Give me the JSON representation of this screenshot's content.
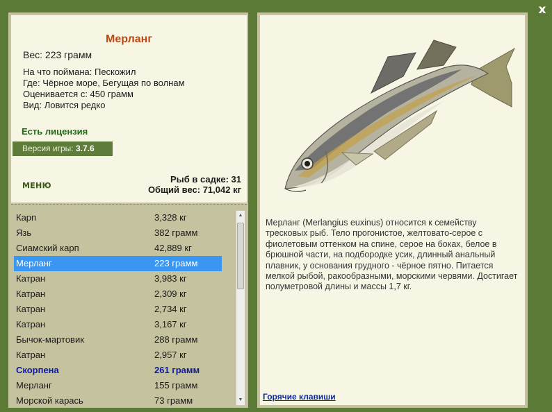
{
  "close_label": "x",
  "fish": {
    "name": "Мерланг",
    "weight": "Вес: 223 грамм",
    "info": [
      "На что поймана: Пескожил",
      "Где: Чёрное море, Бегущая по волнам",
      "Оценивается с: 450 грамм",
      "Вид: Ловится редко"
    ],
    "license": "Есть лицензия",
    "description": "Мерланг (Merlangius euxinus) относится к семейству тресковых рыб. Тело прогонистое, желтовато-серое с фиолетовым оттенком на спине, серое на боках, белое в брюшной части, на подбородке усик, длинный анальный плавник, у основания грудного - чёрное пятно. Питается мелкой рыбой, ракообразными, морскими червями. Достигает полуметровой длины и массы 1,7 кг."
  },
  "version": {
    "label": "Версия игры: ",
    "value": "3.7.6"
  },
  "menu_label": "МЕНЮ",
  "stats": {
    "fish_count": "Рыб в садке: 31",
    "total_weight": "Общий вес: 71,042 кг"
  },
  "catch_list": [
    {
      "name": "Карп",
      "weight": "3,328 кг"
    },
    {
      "name": "Язь",
      "weight": "382 грамм"
    },
    {
      "name": "Сиамский карп",
      "weight": "42,889 кг"
    },
    {
      "name": "Мерланг",
      "weight": "223 грамм"
    },
    {
      "name": "Катран",
      "weight": "3,983 кг"
    },
    {
      "name": "Катран",
      "weight": "2,309 кг"
    },
    {
      "name": "Катран",
      "weight": "2,734 кг"
    },
    {
      "name": "Катран",
      "weight": "3,167 кг"
    },
    {
      "name": "Бычок-мартовик",
      "weight": "288 грамм"
    },
    {
      "name": "Катран",
      "weight": "2,957 кг"
    },
    {
      "name": "Скорпена",
      "weight": "261 грамм"
    },
    {
      "name": "Мерланг",
      "weight": "155 грамм"
    },
    {
      "name": "Морской карась",
      "weight": "73 грамм"
    }
  ],
  "selected_index": 3,
  "highlight_index": 10,
  "hotkeys_label": "Горячие клавиши",
  "colors": {
    "background": "#5a7a36",
    "panel": "#f7f6e4",
    "fish_name": "#b84a12",
    "license": "#1c6a12",
    "selected_row": "#3a96f0",
    "highlight_row": "#0e1aa0",
    "hotkeys_link": "#0b2a9a"
  },
  "icons": {
    "close": "close-icon",
    "scroll_up": "chevron-up-icon",
    "scroll_down": "chevron-down-icon"
  }
}
